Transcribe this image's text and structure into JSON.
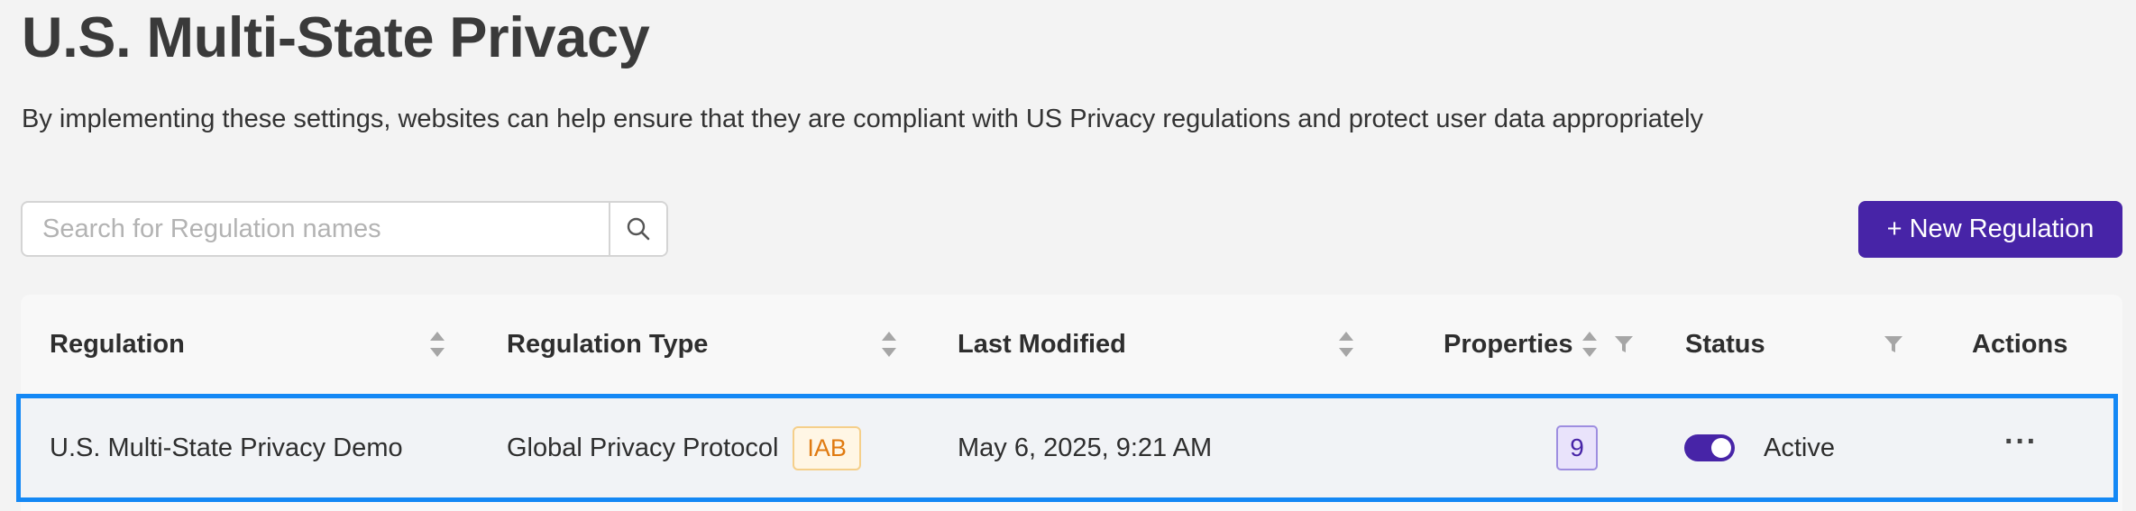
{
  "page": {
    "title": "U.S. Multi-State Privacy",
    "description": "By implementing these settings, websites can help ensure that they are compliant with US Privacy regulations and protect user data appropriately"
  },
  "search": {
    "placeholder": "Search for Regulation names",
    "value": ""
  },
  "toolbar": {
    "new_regulation_label": "+ New Regulation"
  },
  "table": {
    "columns": [
      {
        "label": "Regulation",
        "sortable": true,
        "filterable": false
      },
      {
        "label": "Regulation Type",
        "sortable": true,
        "filterable": false
      },
      {
        "label": "Last Modified",
        "sortable": true,
        "filterable": false
      },
      {
        "label": "Properties",
        "sortable": true,
        "filterable": true
      },
      {
        "label": "Status",
        "sortable": false,
        "filterable": true
      },
      {
        "label": "Actions",
        "sortable": false,
        "filterable": false
      }
    ],
    "rows": [
      {
        "regulation": "U.S. Multi-State Privacy Demo",
        "regulation_type": "Global Privacy Protocol",
        "type_tag": "IAB",
        "last_modified": "May 6, 2025, 9:21 AM",
        "properties": "9",
        "status": "Active",
        "status_enabled": true,
        "actions_label": "···"
      }
    ]
  },
  "colors": {
    "primary": "#4724a7",
    "selected_row_border": "#1488f5",
    "tag_text": "#e07a10",
    "tag_border": "#f5cf8a"
  },
  "icons": {
    "search": "search-icon",
    "sort": "sort-icon",
    "filter": "filter-icon"
  }
}
